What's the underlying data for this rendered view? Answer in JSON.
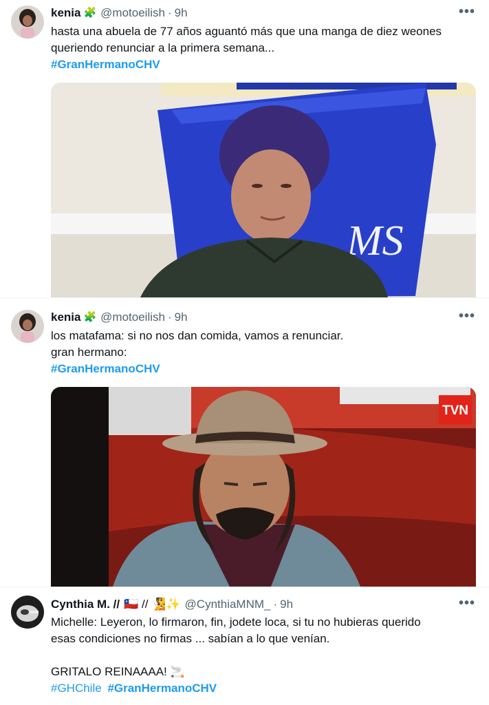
{
  "tweets": [
    {
      "display_name": "kenia",
      "badge": "🧩",
      "handle": "@motoeilish",
      "time": "9h",
      "lines": [
        "hasta una abuela de 77 años aguantó más que una manga de diez weones",
        "queriendo renunciar a la primera semana..."
      ],
      "hashtags": [
        "#GranHermanoCHV"
      ],
      "more": "•••",
      "media": {
        "logo": "MS"
      }
    },
    {
      "display_name": "kenia",
      "badge": "🧩",
      "handle": "@motoeilish",
      "time": "9h",
      "lines": [
        "los matafama: si no nos dan comida, vamos a renunciar.",
        "gran hermano:"
      ],
      "hashtags": [
        "#GranHermanoCHV"
      ],
      "more": "•••",
      "media": {
        "logo": "TVN"
      }
    },
    {
      "display_name": "Cynthia M. //",
      "flags": "🇨🇱 // 🧏✨",
      "handle": "@CynthiaMNM_",
      "time": "9h",
      "lines": [
        "Michelle: Leyeron, lo firmaron, fin, jodete loca, si tu no hubieras querido",
        "esas condiciones no firmas ... sabían a lo que venían.",
        "",
        "GRITALO REINAAAA! 🚬"
      ],
      "hashtags": [
        "#GHChile",
        "#GranHermanoCHV"
      ],
      "more": "•••"
    }
  ],
  "colors": {
    "link": "#1d9bf0",
    "muted": "#536471",
    "text": "#0f1419"
  }
}
